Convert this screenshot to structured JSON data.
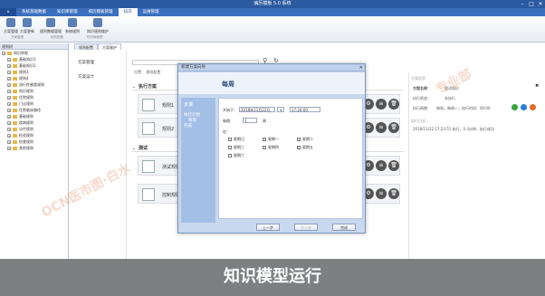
{
  "window": {
    "title": "病历模板 5.0 系统",
    "minimize": "–",
    "maximize": "□",
    "close": "✕"
  },
  "menu": {
    "home": "⌂",
    "items": [
      "系统基础数据",
      "知识库管理",
      "病历模板管理",
      "知识",
      "运维管理"
    ],
    "active_index": 3
  },
  "ribbon": {
    "buttons": [
      "方案管理",
      "方案更新",
      "规则数据管理",
      "系统规则",
      "知识规则维护"
    ],
    "groups": [
      "方案管理",
      "规则配置",
      "知识库管理"
    ]
  },
  "left_pane": {
    "header": "规则树",
    "nodes": [
      "知识库根",
      "基础知识1",
      "基础知识2",
      "规则3",
      "规则4",
      "流行性感冒规则",
      "知识规则",
      "住院规则",
      "门诊规则",
      "住院临床路径",
      "基础规则",
      "疾病规则",
      "诊疗规则",
      "检验规则",
      "检查规则",
      "其他规则"
    ]
  },
  "tabs": [
    "规则配置",
    "方案维护"
  ],
  "nav": {
    "item1": "方案管理",
    "item2": "方案设计"
  },
  "main": {
    "breadcrumb": "位置： 规则配置",
    "section1": "执行方案",
    "section2": "测试",
    "cards": [
      "规则1",
      "规则2",
      "测试规则",
      "控制规则"
    ]
  },
  "right_pane": {
    "title": "方案信息",
    "name_label": "方案名称：",
    "name_value": "测试知识",
    "type_label": "执行状态：",
    "type_value": "未执行",
    "cycle_label": "执行周期：",
    "cycle_value": "每周，每周一，执行时间：00:00",
    "time_label": "执行日志：",
    "time_value": "2018/11/22 17:23:51 执行，0.3分钟，执行成功",
    "close": "✖"
  },
  "dialog": {
    "title": "新建方案向导",
    "heading": "每周",
    "steps_title": "步骤",
    "step1": "执行计划",
    "step2": "每周",
    "step3": "完成",
    "start_label": "开始于：",
    "start_value": "2018年11月22日",
    "time_value": "17:24:00",
    "every_label": "每隔",
    "every_value": "1",
    "every_unit": "周",
    "on_label": "在：",
    "days": [
      "星期日",
      "星期一",
      "星期二",
      "星期三",
      "星期四",
      "星期五",
      "星期六"
    ],
    "btn_prev": "上一步",
    "btn_next": "下一步",
    "btn_done": "完成"
  },
  "watermark": [
    "OCN医市图·白水",
    "专业部"
  ],
  "caption": "知识模型运行"
}
